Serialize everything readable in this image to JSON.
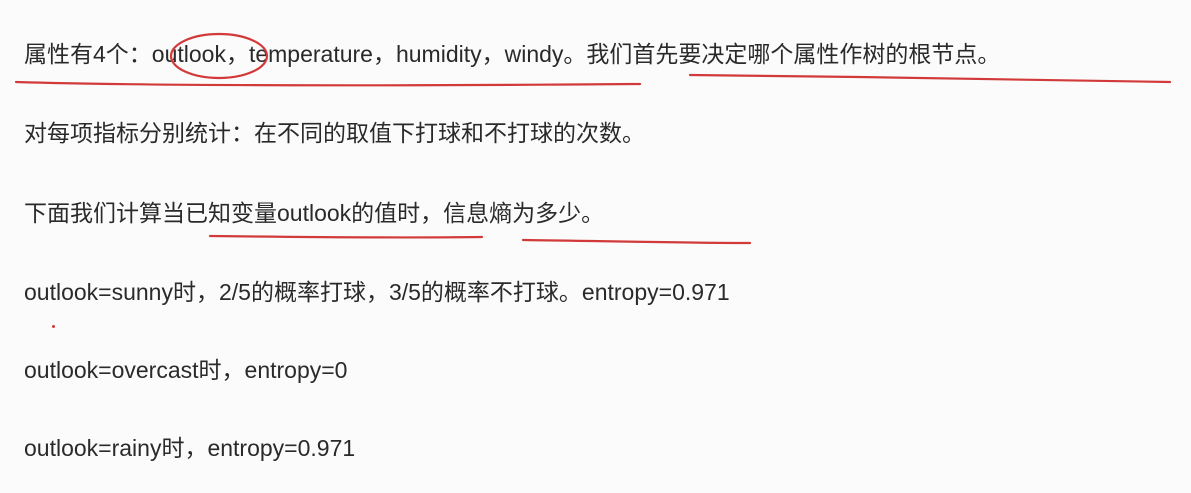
{
  "lines": {
    "line1": {
      "prefix": "属性有4个：",
      "outlook": "outlook",
      "rest": "，temperature，humidity，windy。",
      "highlight": "我们首先要决定哪个属性作树的根节点。"
    },
    "line2": {
      "text": "对每项指标分别统计：在不同的取值下打球和不打球的次数。"
    },
    "line3": {
      "prefix": "下面我们计算当",
      "underlined1": "已知变量outlook的值时",
      "middle": "，",
      "underlined2": "信息熵为多少。"
    },
    "line4": {
      "text": "outlook=sunny时，2/5的概率打球，3/5的概率不打球。entropy=0.971"
    },
    "line5": {
      "text": "outlook=overcast时，entropy=0"
    },
    "line6": {
      "text": "outlook=rainy时，entropy=0.971"
    }
  },
  "colors": {
    "text": "#2a2a2a",
    "annotation": "#d23a3a",
    "background": "#fbfbfb"
  }
}
